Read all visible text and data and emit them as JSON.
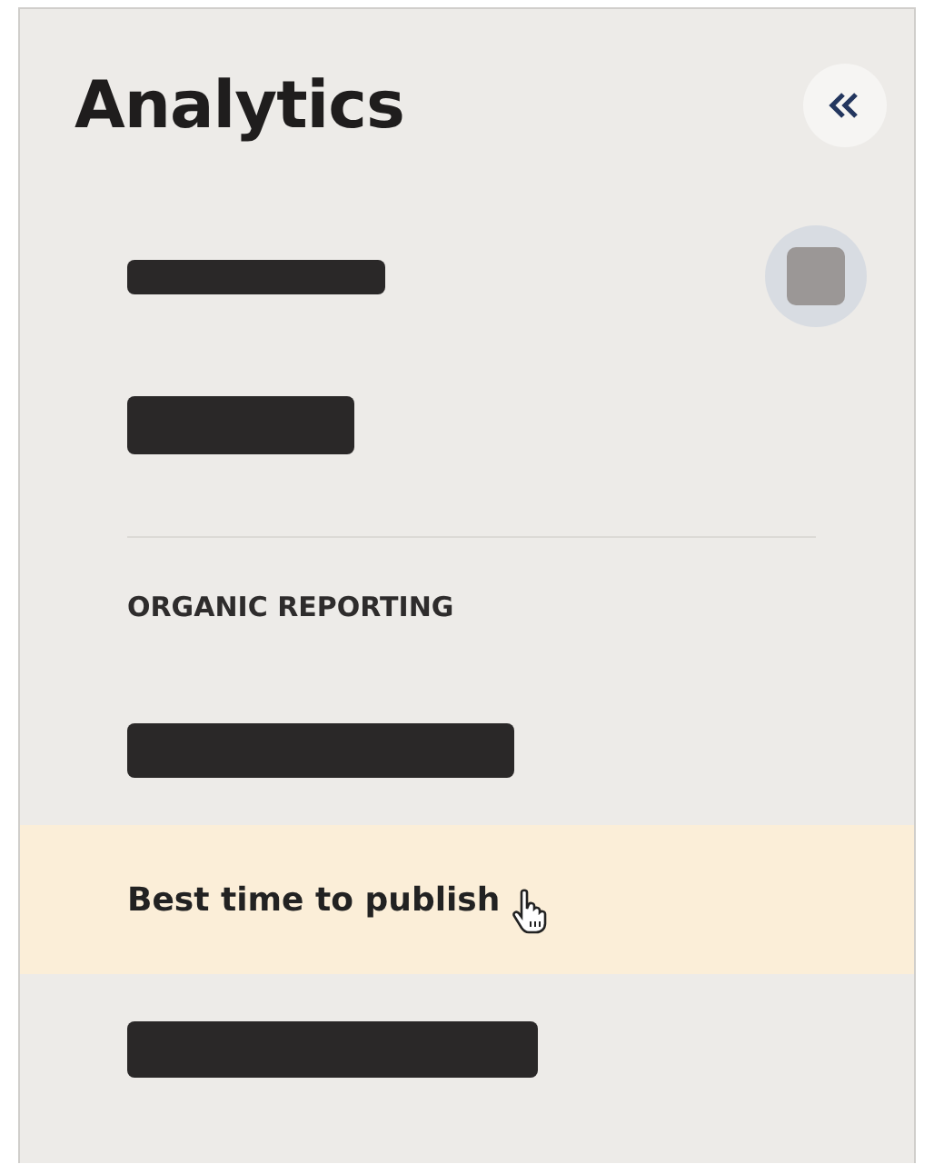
{
  "sidebar": {
    "title": "Analytics",
    "sections": [
      {
        "items": [
          {
            "kind": "redacted",
            "toggle": true,
            "selected": false
          },
          {
            "kind": "redacted",
            "toggle": false,
            "selected": false
          }
        ]
      },
      {
        "heading": "ORGANIC REPORTING",
        "items": [
          {
            "kind": "redacted",
            "toggle": false,
            "selected": false
          },
          {
            "kind": "text",
            "label": "Best time to publish",
            "toggle": false,
            "selected": true,
            "hovered": true
          },
          {
            "kind": "redacted",
            "toggle": false,
            "selected": false
          }
        ]
      }
    ]
  }
}
